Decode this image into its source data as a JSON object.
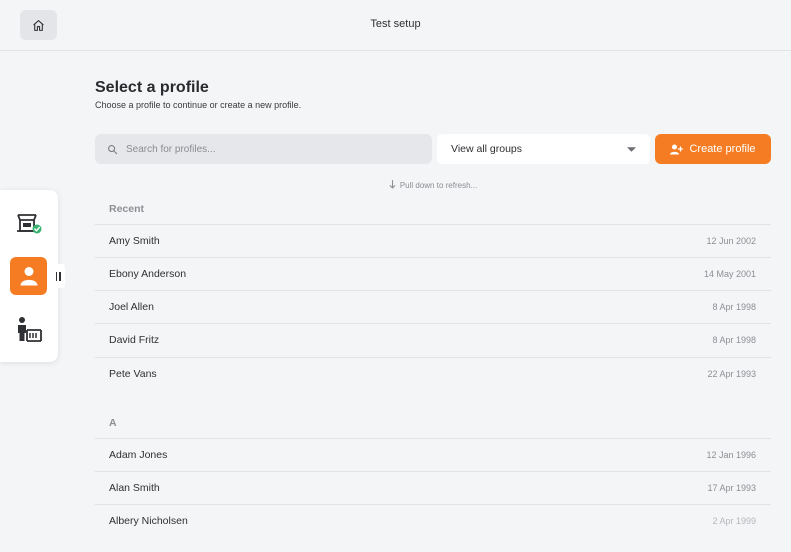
{
  "header": {
    "title": "Test setup"
  },
  "page": {
    "title": "Select a profile",
    "subtitle": "Choose a profile to continue or create a new profile."
  },
  "search": {
    "placeholder": "Search for profiles...",
    "value": ""
  },
  "group_filter": {
    "selected": "View all groups"
  },
  "create_button": {
    "label": "Create profile"
  },
  "pull_hint": "Pull down to refresh...",
  "sections": [
    {
      "heading": "Recent",
      "rows": [
        {
          "name": "Amy Smith",
          "date": "12 Jun 2002"
        },
        {
          "name": "Ebony Anderson",
          "date": "14 May 2001"
        },
        {
          "name": "Joel Allen",
          "date": "8 Apr 1998"
        },
        {
          "name": "David Fritz",
          "date": "8 Apr 1998"
        },
        {
          "name": "Pete Vans",
          "date": "22 Apr 1993"
        }
      ]
    },
    {
      "heading": "A",
      "rows": [
        {
          "name": "Adam Jones",
          "date": "12 Jan 1996"
        },
        {
          "name": "Alan Smith",
          "date": "17 Apr 1993"
        },
        {
          "name": "Albery Nicholsen",
          "date": "2 Apr 1999"
        }
      ]
    }
  ],
  "sidebar": {
    "items": [
      {
        "icon": "store-check-icon",
        "active": false
      },
      {
        "icon": "person-icon",
        "active": true
      },
      {
        "icon": "person-at-counter-icon",
        "active": false
      }
    ]
  },
  "colors": {
    "accent": "#f57c22",
    "background": "#f4f5f7",
    "check_green": "#3bb273",
    "muted_text": "#8d8f94"
  }
}
